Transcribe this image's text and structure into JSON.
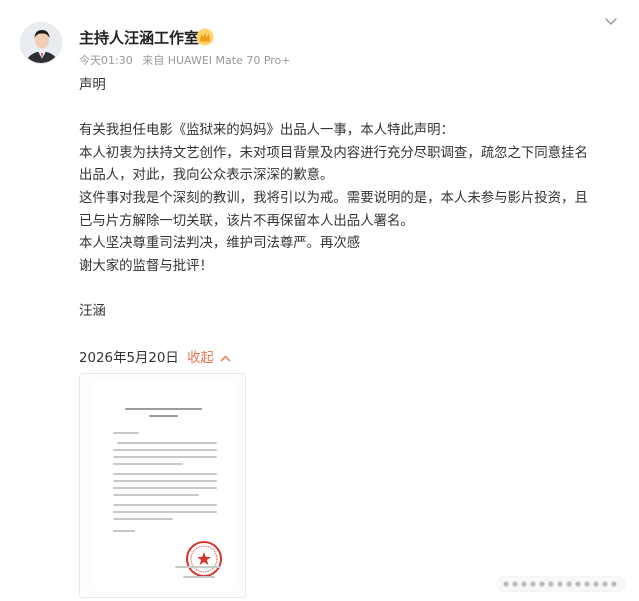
{
  "post": {
    "author": "主持人汪涵工作室",
    "time": "今天01:30",
    "source": "来自 HUAWEI Mate 70 Pro+",
    "body_lines": [
      "声明",
      "有关我担任电影《监狱来的妈妈》出品人一事，本人特此声明：",
      "本人初衷为扶持文艺创作，未对项目背景及内容进行充分尽职调查，疏忽之下同意挂名",
      "出品人，对此，我向公众表示深深的歉意。",
      "这件事对我是个深刻的教训，我将引以为戒。需要说明的是，本人未参与影片投资，且",
      "已与片方解除一切关联，该片不再保留本人出品人署名。",
      "本人坚决尊重司法判决，维护司法尊严。再次感",
      "谢大家的监督与批评！",
      "汪涵"
    ],
    "date": "2026年5月20日",
    "collapse_label": "收起"
  },
  "icons": {
    "vip": "crown-badge-icon",
    "menu": "chevron-down-icon",
    "collapse": "chevron-up-icon",
    "more": "ellipsis-dots-icon"
  },
  "colors": {
    "accent": "#eb7350",
    "meta": "#999999",
    "text": "#333333",
    "seal": "#d9342b"
  }
}
